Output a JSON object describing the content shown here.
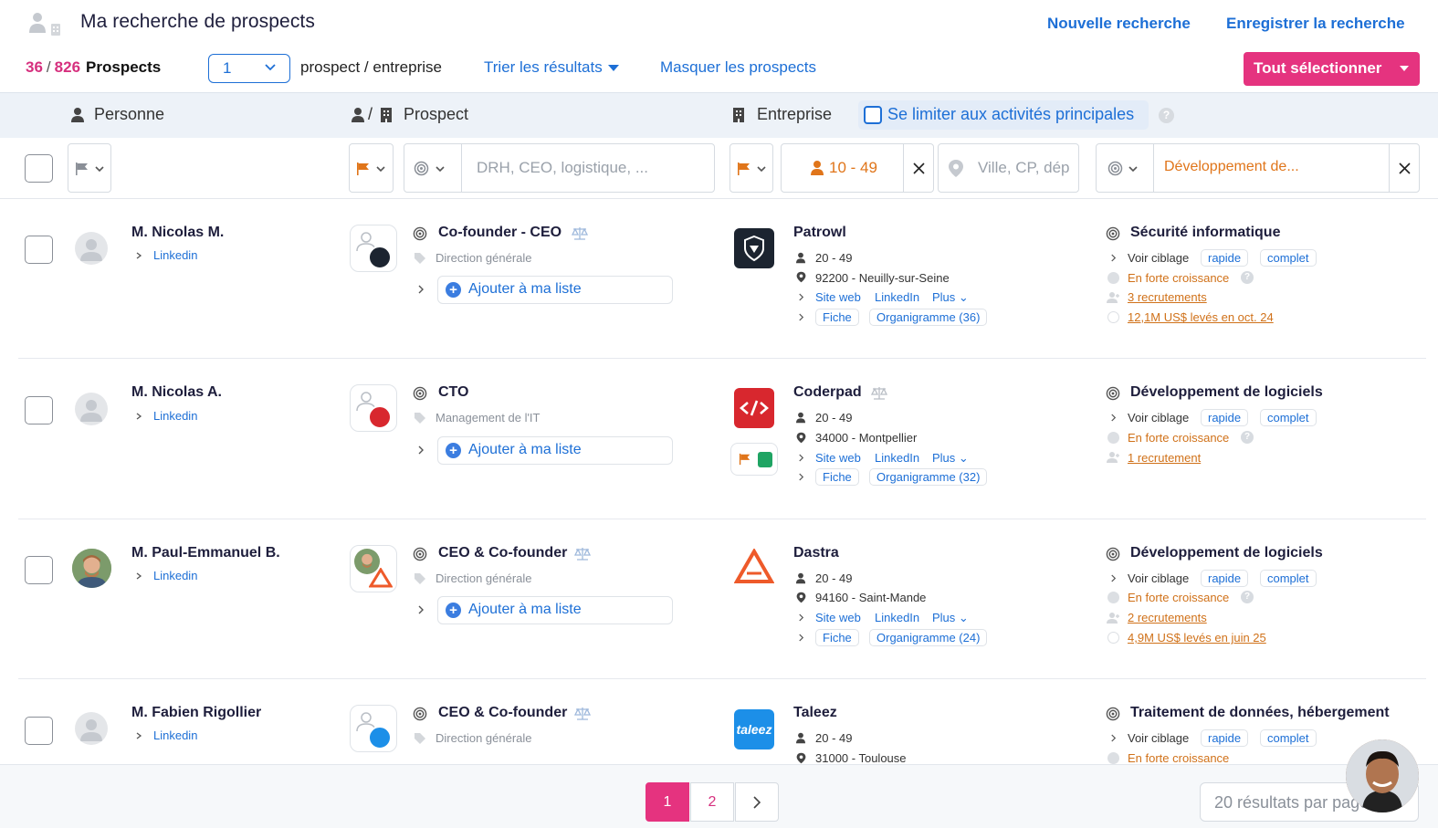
{
  "header": {
    "title": "Ma recherche de prospects",
    "new_search": "Nouvelle recherche",
    "save_search": "Enregistrer la recherche"
  },
  "toolbar": {
    "count_shown": "36",
    "count_sep": "/",
    "count_total": "826",
    "count_label": "Prospects",
    "per_company_value": "1",
    "per_company_label": "prospect / entreprise",
    "sort_label": "Trier les résultats",
    "hide_label": "Masquer les prospects",
    "select_all": "Tout sélectionner"
  },
  "columns": {
    "person": "Personne",
    "prospect_prefix": "/",
    "prospect": "Prospect",
    "company": "Entreprise",
    "limit_label": "Se limiter aux activités principales",
    "help": "?"
  },
  "filters": {
    "job_placeholder": "DRH, CEO, logistique, ...",
    "size_value": "10 - 49",
    "location_placeholder": "Ville, CP, dép",
    "activity_value": "Développement de..."
  },
  "rows": [
    {
      "name": "M. Nicolas M.",
      "linkedin": "Linkedin",
      "role": "Co-founder - CEO",
      "dept": "Direction générale",
      "add": "Ajouter à ma liste",
      "company": "Patrowl",
      "size": "20 - 49",
      "location": "92200 - Neuilly-sur-Seine",
      "site": "Site web",
      "company_linkedin": "LinkedIn",
      "plus": "Plus",
      "fiche": "Fiche",
      "org": "Organigramme (36)",
      "sector": "Sécurité informatique",
      "targeting": "Voir ciblage",
      "quick": "rapide",
      "full": "complet",
      "growth": "En forte croissance",
      "recruit": "3 recrutements",
      "funding": "12,1M US$ levés en oct. 24"
    },
    {
      "name": "M. Nicolas A.",
      "linkedin": "Linkedin",
      "role": "CTO",
      "dept": "Management de l'IT",
      "add": "Ajouter à ma liste",
      "company": "Coderpad",
      "size": "20 - 49",
      "location": "34000 - Montpellier",
      "site": "Site web",
      "company_linkedin": "LinkedIn",
      "plus": "Plus",
      "fiche": "Fiche",
      "org": "Organigramme (32)",
      "sector": "Développement de logiciels",
      "targeting": "Voir ciblage",
      "quick": "rapide",
      "full": "complet",
      "growth": "En forte croissance",
      "recruit": "1 recrutement"
    },
    {
      "name": "M. Paul-Emmanuel B.",
      "linkedin": "Linkedin",
      "role": "CEO & Co-founder",
      "dept": "Direction générale",
      "add": "Ajouter à ma liste",
      "company": "Dastra",
      "size": "20 - 49",
      "location": "94160 - Saint-Mande",
      "site": "Site web",
      "company_linkedin": "LinkedIn",
      "plus": "Plus",
      "fiche": "Fiche",
      "org": "Organigramme (24)",
      "sector": "Développement de logiciels",
      "targeting": "Voir ciblage",
      "quick": "rapide",
      "full": "complet",
      "growth": "En forte croissance",
      "recruit": "2 recrutements",
      "funding": "4,9M US$ levés en juin 25"
    },
    {
      "name": "M. Fabien Rigollier",
      "linkedin": "Linkedin",
      "role": "CEO & Co-founder",
      "dept": "Direction générale",
      "company": "Taleez",
      "logo_text": "taleez",
      "size": "20 - 49",
      "location": "31000 - Toulouse",
      "sector": "Traitement de données, hébergement",
      "targeting": "Voir ciblage",
      "quick": "rapide",
      "full": "complet",
      "growth": "En forte croissance"
    }
  ],
  "pagination": {
    "page1": "1",
    "page2": "2",
    "per_page": "20 résultats par page"
  },
  "colors": {
    "accent_blue": "#1d6fd6",
    "accent_pink": "#e5337f",
    "orange": "#e0751a"
  },
  "icons": [
    "user-company-icon",
    "flag-icon",
    "target-icon",
    "location-icon",
    "balance-icon",
    "chevron-down-icon",
    "chevron-right-icon",
    "close-icon",
    "building-icon",
    "user-icon"
  ]
}
